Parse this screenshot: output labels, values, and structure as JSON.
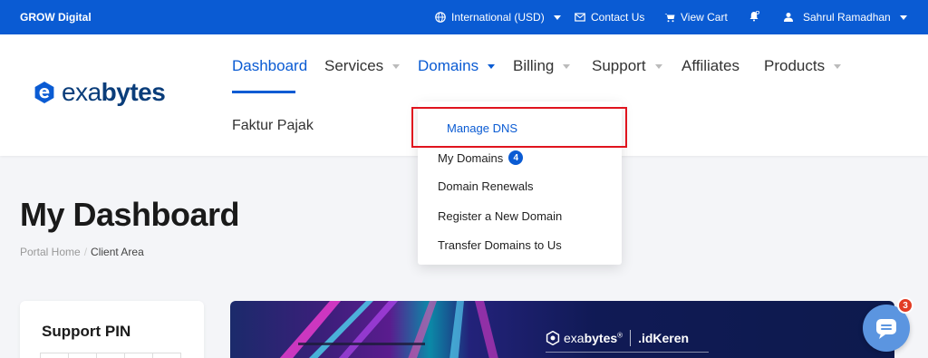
{
  "topbar": {
    "brand": "GROW Digital",
    "currency": "International (USD)",
    "contact": "Contact Us",
    "cart": "View Cart",
    "user": "Sahrul Ramadhan"
  },
  "logo": {
    "prefix": "exa",
    "bold": "bytes"
  },
  "nav": {
    "dashboard": "Dashboard",
    "services": "Services",
    "domains": "Domains",
    "billing": "Billing",
    "support": "Support",
    "affiliates": "Affiliates",
    "products": "Products",
    "faktur": "Faktur Pajak"
  },
  "dropdown": {
    "manage_dns": "Manage DNS",
    "my_domains": "My Domains",
    "my_domains_count": "4",
    "renewals": "Domain Renewals",
    "register": "Register a New Domain",
    "transfer": "Transfer Domains to Us"
  },
  "page": {
    "title": "My Dashboard",
    "breadcrumb_home": "Portal Home",
    "breadcrumb_sep": "/",
    "breadcrumb_current": "Client Area"
  },
  "pin": {
    "title": "Support PIN"
  },
  "banner": {
    "brand1_prefix": "exa",
    "brand1_bold": "bytes",
    "brand1_mark": "®",
    "brand2": ".idKeren"
  },
  "chat": {
    "badge": "3"
  },
  "colors": {
    "primary": "#0a5bd3",
    "highlight": "#e0141e",
    "logo_dark": "#0a3d7a"
  }
}
